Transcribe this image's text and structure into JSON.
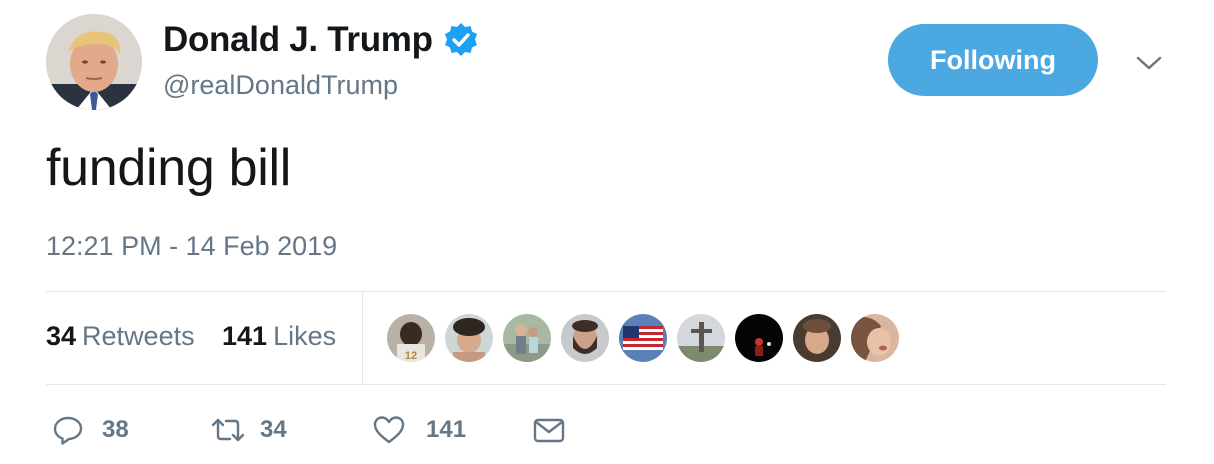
{
  "user": {
    "name": "Donald J. Trump",
    "handle": "@realDonaldTrump",
    "verified": true,
    "follow_label": "Following"
  },
  "tweet": {
    "text": "funding bill",
    "timestamp": "12:21 PM - 14 Feb 2019"
  },
  "stats": {
    "retweets_count": "34",
    "retweets_label": "Retweets",
    "likes_count": "141",
    "likes_label": "Likes"
  },
  "likers": [
    {
      "icon": "avatar-football-player"
    },
    {
      "icon": "avatar-curly-hair"
    },
    {
      "icon": "avatar-outdoor-couple"
    },
    {
      "icon": "avatar-bearded-man"
    },
    {
      "icon": "avatar-us-flag"
    },
    {
      "icon": "avatar-cross-landscape"
    },
    {
      "icon": "avatar-dark-stage"
    },
    {
      "icon": "avatar-young-man"
    },
    {
      "icon": "avatar-woman-portrait"
    }
  ],
  "actions": {
    "reply_count": "38",
    "retweet_count": "34",
    "like_count": "141"
  },
  "colors": {
    "accent": "#4ba8e0",
    "verified": "#1da1f2",
    "muted": "#657786",
    "text": "#14171a",
    "divider": "#e1e8ed"
  }
}
